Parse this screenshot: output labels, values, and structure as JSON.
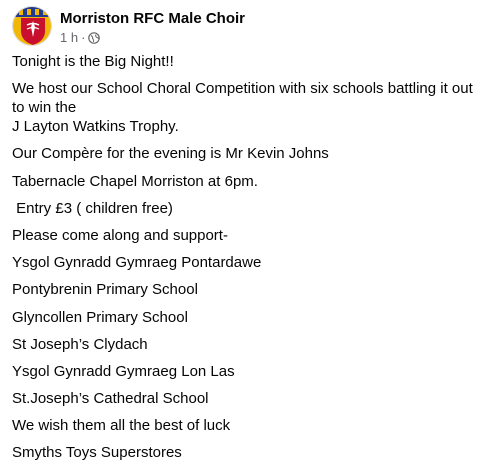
{
  "post": {
    "author": "Morriston RFC Male Choir",
    "time": "1 h",
    "separator": "·",
    "privacy_icon": "globe-icon",
    "avatar_icon": "club-crest-icon",
    "colors": {
      "crest_red": "#c8102e",
      "crest_blue": "#1f3a93",
      "crest_gold": "#f2b705",
      "text": "#050505",
      "meta": "#65676b"
    },
    "lines": [
      "Tonight is the Big Night!!",
      "We host our School Choral Competition with six schools battling it out to win the",
      "J Layton Watkins Trophy.",
      "Our Compère for the evening is Mr Kevin Johns",
      "Tabernacle Chapel Morriston at 6pm.",
      " Entry £3 ( children free)",
      "Please come along and support-",
      "Ysgol Gynradd Gymraeg Pontardawe",
      "Pontybrenin Primary School",
      "Glyncollen Primary School",
      "St Joseph’s Clydach",
      "Ysgol Gynradd Gymraeg Lon Las",
      "St.Joseph’s Cathedral School",
      "We wish them all the best of luck",
      "Smyths Toys Superstores"
    ]
  }
}
